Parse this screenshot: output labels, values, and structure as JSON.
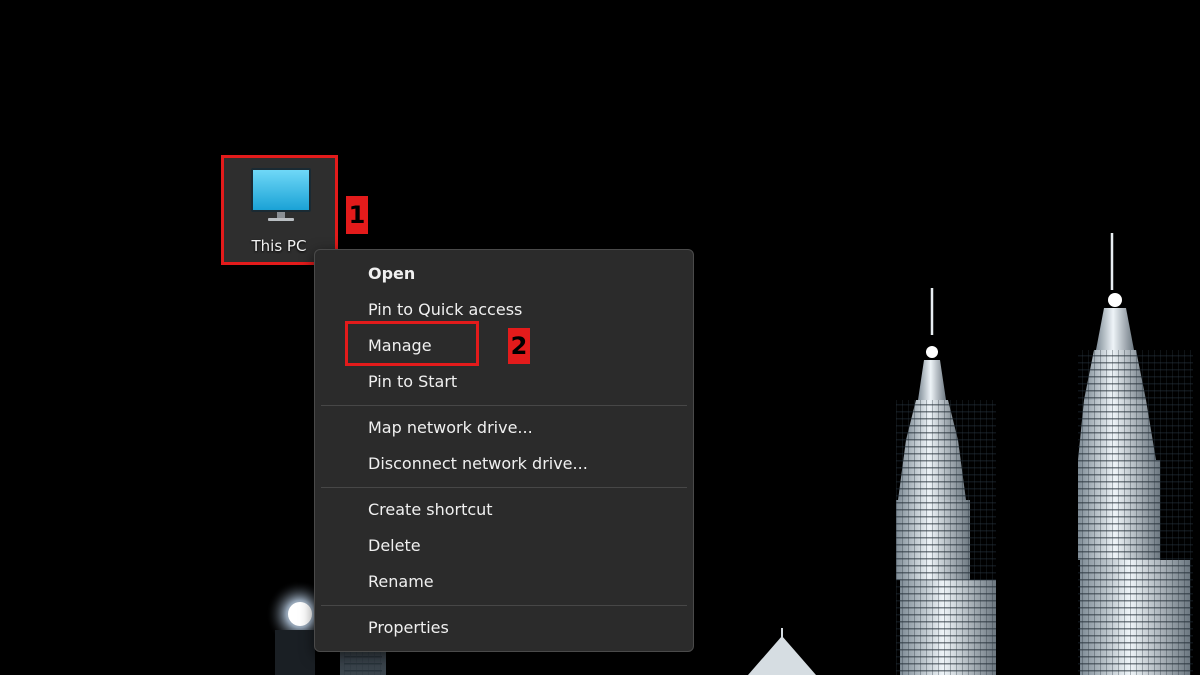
{
  "desktop": {
    "icon": {
      "label": "This PC",
      "icon_name": "monitor-icon",
      "screen_color": "#29b6e8"
    }
  },
  "annotations": [
    {
      "number": "1",
      "target": "This PC"
    },
    {
      "number": "2",
      "target": "Manage"
    }
  ],
  "context_menu": {
    "groups": [
      [
        {
          "label": "Open",
          "bold": true
        },
        {
          "label": "Pin to Quick access"
        },
        {
          "label": "Manage"
        },
        {
          "label": "Pin to Start"
        }
      ],
      [
        {
          "label": "Map network drive..."
        },
        {
          "label": "Disconnect network drive..."
        }
      ],
      [
        {
          "label": "Create shortcut"
        },
        {
          "label": "Delete"
        },
        {
          "label": "Rename"
        }
      ],
      [
        {
          "label": "Properties"
        }
      ]
    ]
  },
  "colors": {
    "annotation": "#e31b1b",
    "menu_background": "#2b2b2b",
    "menu_text": "#f0f0f0",
    "wallpaper": "#000000"
  }
}
